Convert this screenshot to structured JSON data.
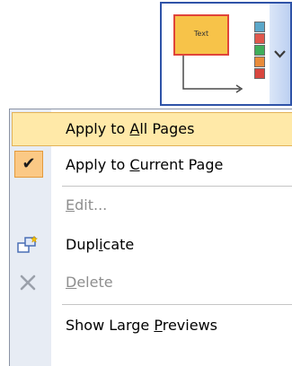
{
  "gallery": {
    "preview_text": "Text",
    "swatch_colors": [
      "#5ba7c9",
      "#e0574c",
      "#3fae5b",
      "#e88b3a",
      "#d8463e"
    ]
  },
  "menu": {
    "items": [
      {
        "id": "apply-all",
        "pre": "Apply to ",
        "key": "A",
        "post": "ll Pages",
        "state": "highlighted"
      },
      {
        "id": "apply-current",
        "pre": "Apply to ",
        "key": "C",
        "post": "urrent Page",
        "state": "checked"
      },
      {
        "id": "edit",
        "pre": "",
        "key": "E",
        "post": "dit...",
        "state": "disabled"
      },
      {
        "id": "duplicate",
        "pre": "Dupl",
        "key": "i",
        "post": "cate",
        "state": "normal",
        "icon": "duplicate-icon"
      },
      {
        "id": "delete",
        "pre": "",
        "key": "D",
        "post": "elete",
        "state": "disabled",
        "icon": "delete-icon"
      },
      {
        "id": "large-previews",
        "pre": "Show Large ",
        "key": "P",
        "post": "reviews",
        "state": "normal"
      }
    ]
  },
  "colors": {
    "highlight_bg": "#ffe9a8",
    "highlight_border": "#e3b257",
    "check_bg": "#fbc985",
    "gutter": "#e7ecf4",
    "disabled_text": "#8e8e8e"
  }
}
